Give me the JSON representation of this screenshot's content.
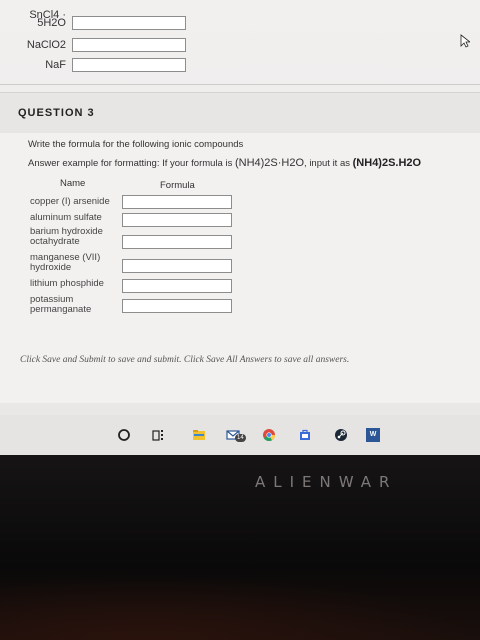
{
  "prev_question": {
    "rows": [
      {
        "label": "SnCl4 ·"
      },
      {
        "label": "5H2O"
      },
      {
        "label": "NaClO2"
      },
      {
        "label": "NaF"
      }
    ]
  },
  "question": {
    "title": "QUESTION 3",
    "instruction": "Write the formula for the following ionic compounds",
    "example_prefix": "Answer example for formatting:  If your formula is",
    "example_formula": "(NH4)2S·H2O",
    "example_mid": ", input it as",
    "example_answer": "(NH4)2S.H2O",
    "col_name": "Name",
    "col_formula": "Formula",
    "rows": [
      {
        "name": "copper (I) arsenide"
      },
      {
        "name": "aluminum sulfate"
      },
      {
        "name": "barium hydroxide octahydrate"
      },
      {
        "name": "manganese (VII) hydroxide"
      },
      {
        "name": "lithium phosphide"
      },
      {
        "name": "potassium permanganate"
      }
    ]
  },
  "footer_note": "Click Save and Submit to save and submit. Click Save All Answers to save all answers.",
  "taskbar": {
    "mail_badge": "14",
    "word_label": "W",
    "icons": [
      "cortana-icon",
      "task-view-icon",
      "file-explorer-icon",
      "mail-icon",
      "chrome-icon",
      "store-icon",
      "steam-icon",
      "word-icon"
    ]
  },
  "bezel": {
    "brand": "ALIENWAR"
  },
  "colors": {
    "chrome": "#dd4b3e",
    "store": "#3b6bd6",
    "word": "#2b5797",
    "explorer": "#f2c12e"
  }
}
